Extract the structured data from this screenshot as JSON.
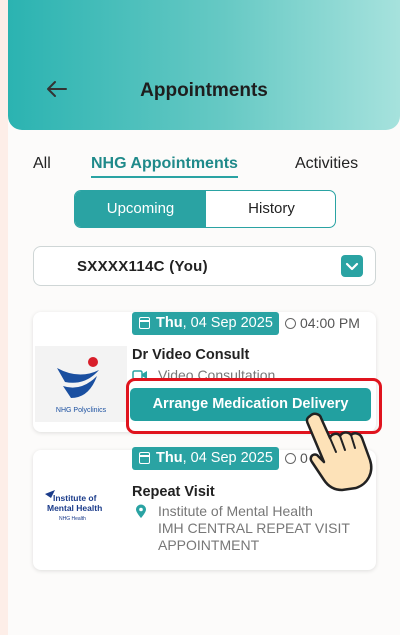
{
  "header": {
    "title": "Appointments"
  },
  "tabs": [
    "All",
    "NHG Appointments",
    "Activities"
  ],
  "segments": [
    "Upcoming",
    "History"
  ],
  "patient_select": {
    "value": "SXXXX114C (You)"
  },
  "appointments": [
    {
      "day": "Thu",
      "date": ", 04 Sep 2025",
      "time": "04:00 PM",
      "title": "Dr Video Consult",
      "type": "Video Consultation",
      "logo": "NHG Polyclinics",
      "action": "Arrange Medication Delivery"
    },
    {
      "day": "Thu",
      "date": ", 04 Sep 2025",
      "time": "0",
      "title": "Repeat Visit",
      "location": "Institute of Mental Health",
      "detail_line1": "IMH CENTRAL REPEAT VISIT",
      "detail_line2": "APPOINTMENT",
      "logo_line1": "Institute of",
      "logo_line2": "Mental Health",
      "logo_line3": "NHG Health"
    }
  ],
  "colors": {
    "accent": "#2aa3a3",
    "highlight": "#e0141e"
  }
}
